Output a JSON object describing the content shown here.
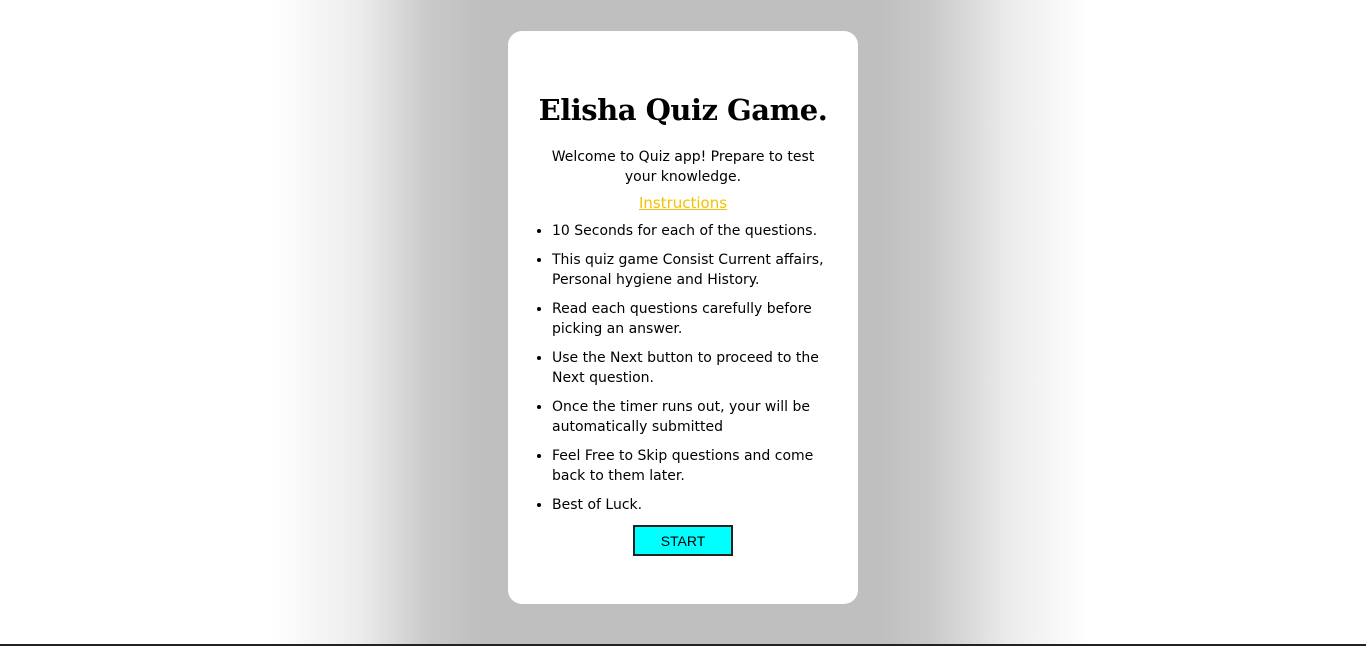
{
  "card": {
    "title": "Elisha Quiz Game.",
    "welcome": "Welcome to Quiz app! Prepare to test your knowledge.",
    "instructions_label": "Instructions",
    "rules": [
      "10 Seconds for each of the questions.",
      "This quiz game Consist Current affairs, Personal hygiene and History.",
      "Read each questions carefully before picking an answer.",
      "Use the Next button to proceed to the Next question.",
      "Once the timer runs out, your will be automatically submitted",
      "Feel Free to Skip questions and come back to them later.",
      "Best of Luck."
    ],
    "start_label": "START"
  },
  "colors": {
    "start_button": "#00ffff",
    "instructions_link": "#f2c200",
    "backdrop": "#bfbfbf"
  }
}
